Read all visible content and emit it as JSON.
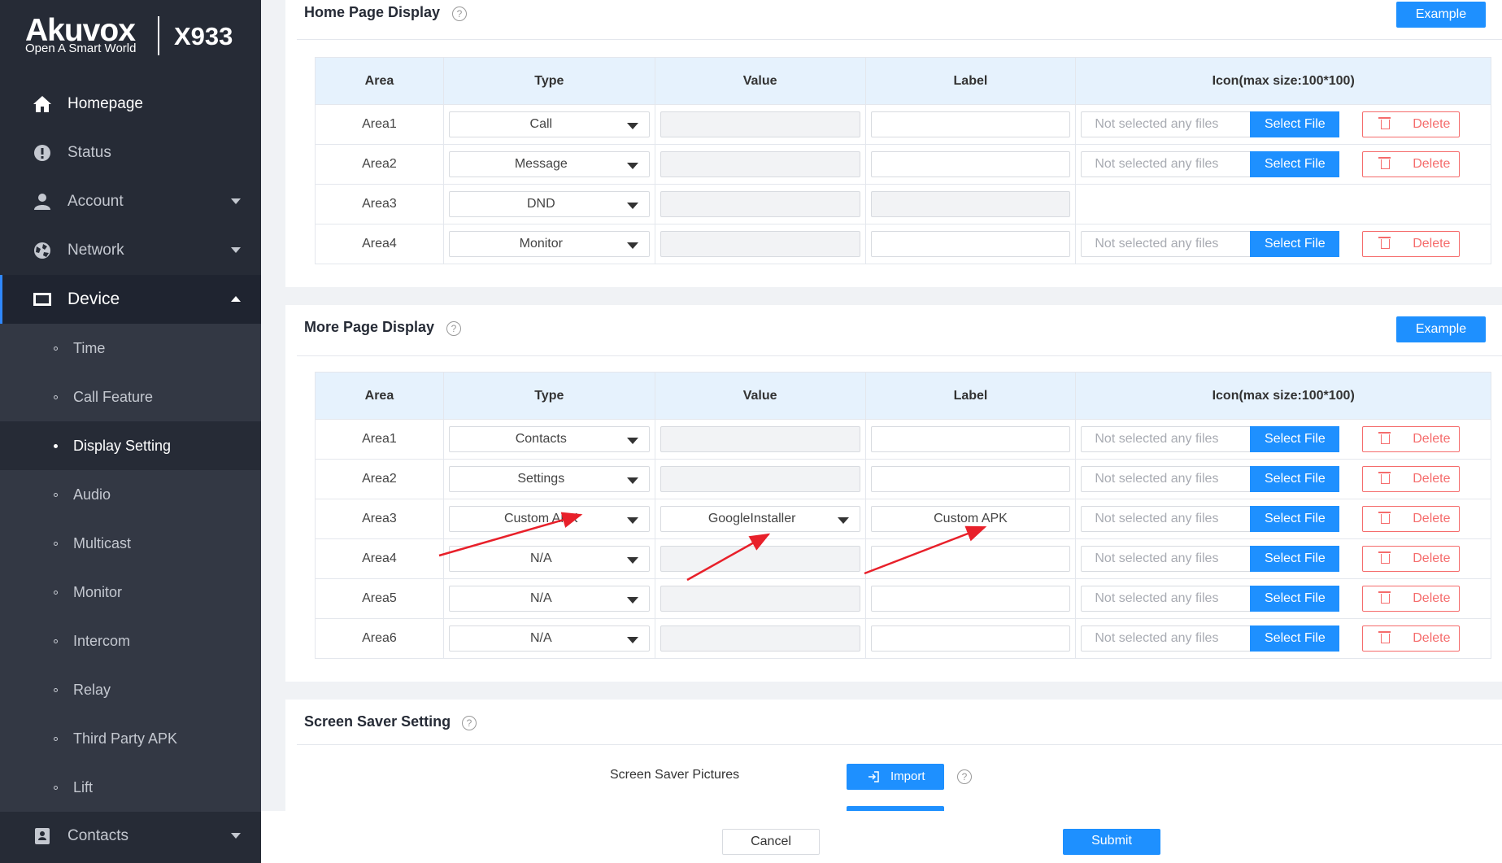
{
  "sidebar": {
    "brand": "Akuvox",
    "slogan": "Open A Smart World",
    "model": "X933",
    "items": [
      {
        "label": "Homepage"
      },
      {
        "label": "Status"
      },
      {
        "label": "Account"
      },
      {
        "label": "Network"
      },
      {
        "label": "Device"
      }
    ],
    "device_sub": [
      {
        "label": "Time"
      },
      {
        "label": "Call Feature"
      },
      {
        "label": "Display Setting"
      },
      {
        "label": "Audio"
      },
      {
        "label": "Multicast"
      },
      {
        "label": "Monitor"
      },
      {
        "label": "Intercom"
      },
      {
        "label": "Relay"
      },
      {
        "label": "Third Party APK"
      },
      {
        "label": "Lift"
      }
    ],
    "contacts": "Contacts"
  },
  "home": {
    "title": "Home Page Display",
    "help": "?",
    "example": "Example",
    "headers": [
      "Area",
      "Type",
      "Value",
      "Label",
      "Icon(max size:100*100)"
    ],
    "rows": [
      {
        "area": "Area1",
        "type": "Call",
        "value": "",
        "label": ""
      },
      {
        "area": "Area2",
        "type": "Message",
        "value": "",
        "label": ""
      },
      {
        "area": "Area3",
        "type": "DND",
        "value": "",
        "label": ""
      },
      {
        "area": "Area4",
        "type": "Monitor",
        "value": "",
        "label": ""
      }
    ]
  },
  "more": {
    "title": "More Page Display",
    "help": "?",
    "example": "Example",
    "headers": [
      "Area",
      "Type",
      "Value",
      "Label",
      "Icon(max size:100*100)"
    ],
    "rows": [
      {
        "area": "Area1",
        "type": "Contacts",
        "value": "",
        "label": ""
      },
      {
        "area": "Area2",
        "type": "Settings",
        "value": "",
        "label": ""
      },
      {
        "area": "Area3",
        "type": "Custom APK",
        "value": "GoogleInstaller",
        "label": "Custom APK"
      },
      {
        "area": "Area4",
        "type": "N/A",
        "value": "",
        "label": ""
      },
      {
        "area": "Area5",
        "type": "N/A",
        "value": "",
        "label": ""
      },
      {
        "area": "Area6",
        "type": "N/A",
        "value": "",
        "label": ""
      }
    ]
  },
  "file": {
    "placeholder": "Not selected any files",
    "select": "Select File",
    "delete": "Delete"
  },
  "saver": {
    "title": "Screen Saver Setting",
    "help": "?",
    "pictures_label": "Screen Saver Pictures",
    "import": "Import"
  },
  "footer": {
    "cancel": "Cancel",
    "submit": "Submit"
  },
  "colors": {
    "accent": "#1e90ff",
    "sidebar": "#262b36",
    "danger": "#f56c6c",
    "annotation": "#e8202a"
  }
}
